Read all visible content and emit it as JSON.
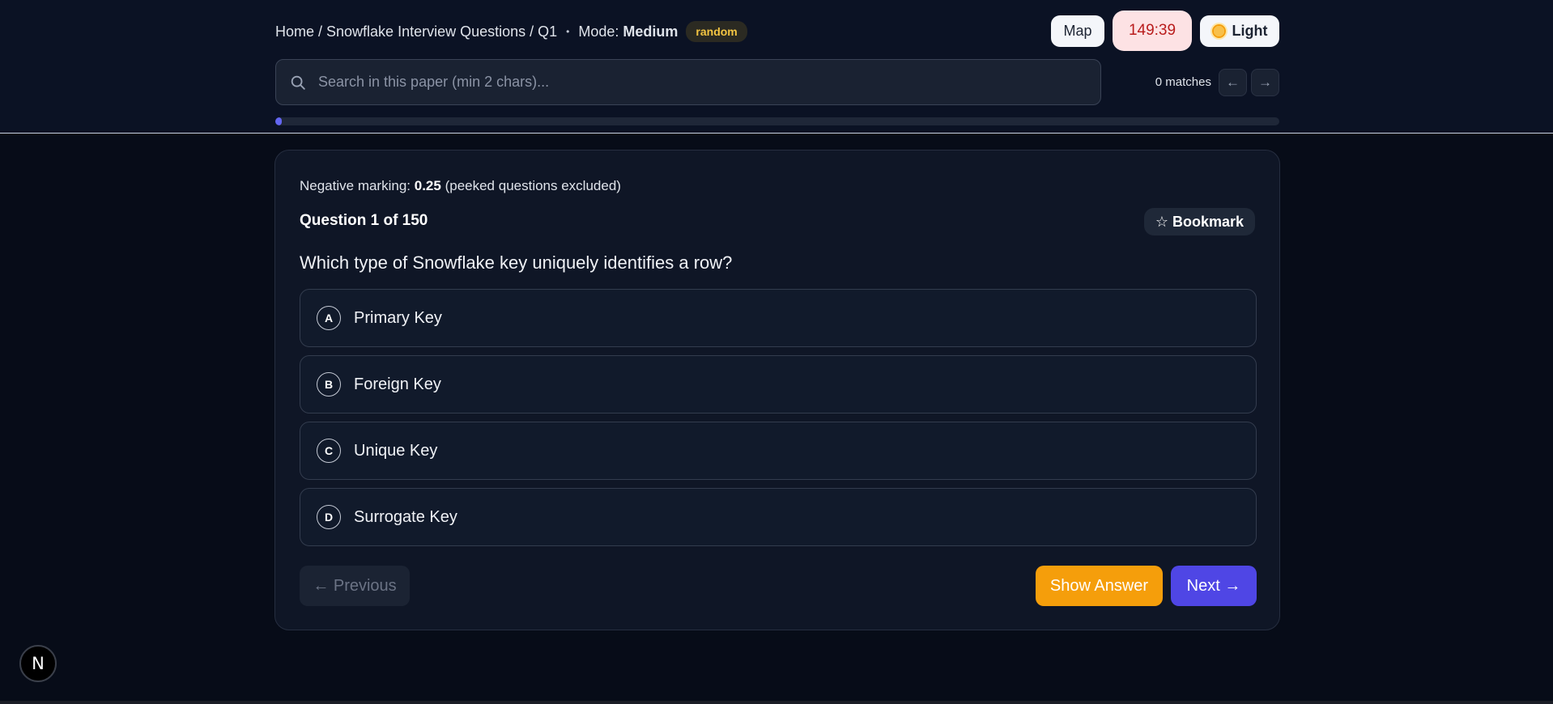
{
  "header": {
    "breadcrumb": "Home / Snowflake Interview Questions / Q1",
    "separator": "•",
    "mode_label": "Mode:",
    "mode_value": "Medium",
    "mode_badge": "random",
    "map_label": "Map",
    "timer": "149:39",
    "theme_label": "Light",
    "search_placeholder": "Search in this paper (min 2 chars)...",
    "matches": "0 matches",
    "prev_match": "←",
    "next_match": "→",
    "progress_fraction": 0.0067
  },
  "card": {
    "negative_prefix": "Negative marking:",
    "negative_value": "0.25",
    "negative_suffix": "(peeked questions excluded)",
    "counter": "Question 1 of 150",
    "bookmark_label": "☆ Bookmark",
    "question": "Which type of Snowflake key uniquely identifies a row?",
    "options": [
      {
        "letter": "A",
        "text": "Primary Key"
      },
      {
        "letter": "B",
        "text": "Foreign Key"
      },
      {
        "letter": "C",
        "text": "Unique Key"
      },
      {
        "letter": "D",
        "text": "Surrogate Key"
      }
    ],
    "prev_label": "← Previous",
    "show_answer_label": "Show Answer",
    "next_label": "Next →"
  },
  "footer": {
    "logo_letter": "N"
  },
  "colors": {
    "accent": "#4f46e5",
    "warning": "#f59e0b",
    "timer_text": "#b91c1c",
    "badge_text": "#f4c542"
  }
}
